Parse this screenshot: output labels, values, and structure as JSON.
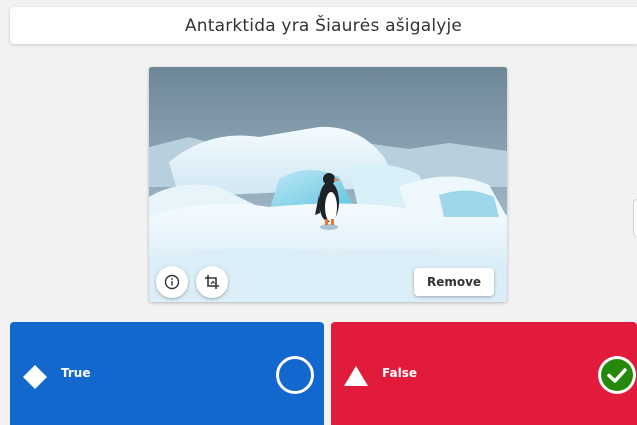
{
  "question": {
    "text": "Antarktida yra Šiaurės ašigalyje"
  },
  "media": {
    "info_icon": "info-icon",
    "crop_icon": "crop-icon",
    "remove_label": "Remove"
  },
  "answers": [
    {
      "label": "True",
      "shape": "diamond",
      "color": "#1368ce",
      "correct": false
    },
    {
      "label": "False",
      "shape": "triangle",
      "color": "#e21b3c",
      "correct": true
    }
  ],
  "colors": {
    "correct_check": "#26890c"
  }
}
